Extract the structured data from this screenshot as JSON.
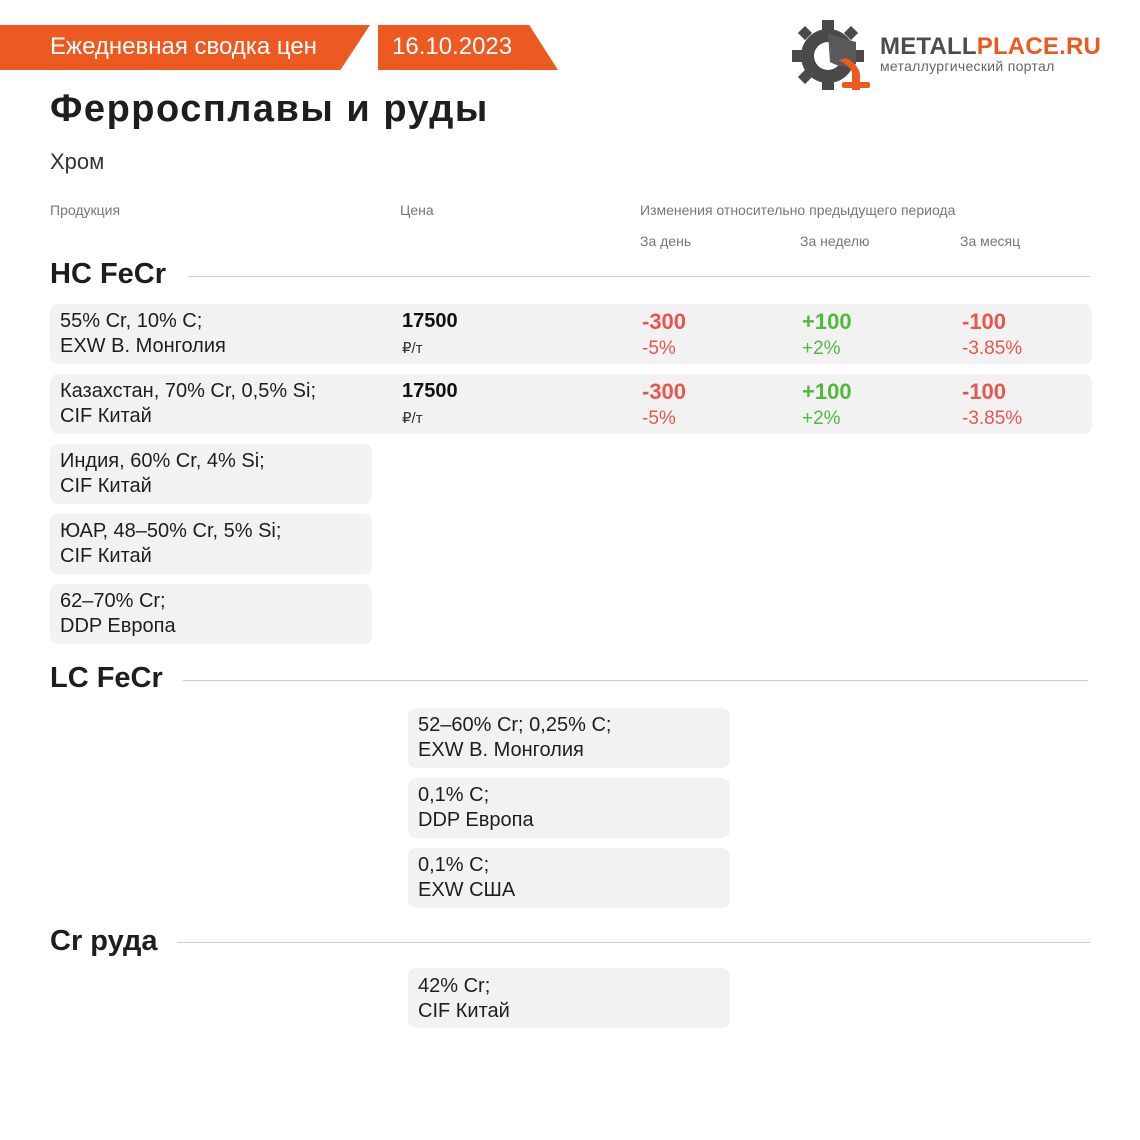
{
  "header": {
    "title": "Ежедневная сводка цен",
    "date": "16.10.2023"
  },
  "logo": {
    "name_a": "METALL",
    "name_b": "PLACE.RU",
    "tagline": "металлургический портал"
  },
  "page": {
    "title": "Ферросплавы и руды",
    "subtitle": "Хром"
  },
  "columns": {
    "product": "Продукция",
    "price": "Цена",
    "changes": "Изменения относительно предыдущего периода",
    "day": "За день",
    "week": "За неделю",
    "month": "За месяц"
  },
  "colors": {
    "accent": "#ec5a22",
    "negative": "#e8574e",
    "positive": "#4fba3c"
  },
  "sections": [
    {
      "title": "HC FeCr",
      "rows": [
        {
          "product": "55% Cr, 10% C;\nEXW В. Монголия",
          "price": "17500",
          "unit": "₽/т",
          "day_abs": "-300",
          "day_pct": "-5%",
          "week_abs": "+100",
          "week_pct": "+2%",
          "month_abs": "-100",
          "month_pct": "-3.85%"
        },
        {
          "product": "Казахстан, 70% Cr, 0,5% Si;\nCIF Китай",
          "price": "17500",
          "unit": "₽/т",
          "day_abs": "-300",
          "day_pct": "-5%",
          "week_abs": "+100",
          "week_pct": "+2%",
          "month_abs": "-100",
          "month_pct": "-3.85%"
        },
        {
          "product": "Индия, 60% Cr, 4% Si;\nCIF Китай"
        },
        {
          "product": "ЮАР, 48–50% Cr, 5% Si;\nCIF Китай"
        },
        {
          "product": "62–70% Cr;\nDDP Европа"
        }
      ]
    },
    {
      "title": "LC FeCr",
      "rows": [
        {
          "product": "52–60% Cr; 0,25% C;\nEXW В. Монголия"
        },
        {
          "product": "0,1% C;\nDDP Европа"
        },
        {
          "product": "0,1% C;\nEXW США"
        }
      ]
    },
    {
      "title": "Cr руда",
      "rows": [
        {
          "product": "42% Cr;\nCIF Китай"
        }
      ]
    }
  ]
}
